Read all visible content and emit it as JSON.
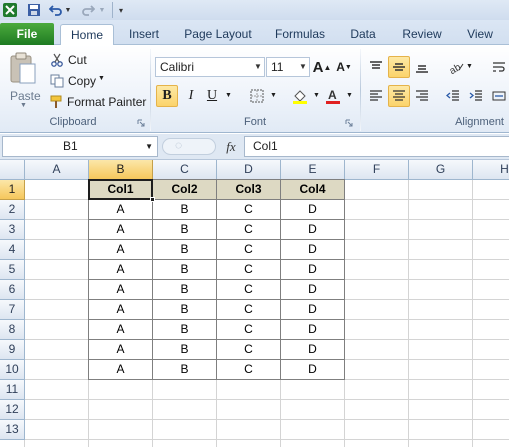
{
  "ribbon_tabs": {
    "file": "File",
    "home": "Home",
    "insert": "Insert",
    "page_layout": "Page Layout",
    "formulas": "Formulas",
    "data": "Data",
    "review": "Review",
    "view": "View"
  },
  "clipboard": {
    "paste": "Paste",
    "cut": "Cut",
    "copy": "Copy",
    "format_painter": "Format Painter",
    "group_label": "Clipboard"
  },
  "font": {
    "name": "Calibri",
    "size": "11",
    "bold": "B",
    "italic": "I",
    "underline": "U",
    "group_label": "Font"
  },
  "alignment": {
    "group_label": "Alignment"
  },
  "formula_bar": {
    "name_box": "B1",
    "fx": "fx",
    "content": "Col1"
  },
  "grid": {
    "columns": [
      "A",
      "B",
      "C",
      "D",
      "E",
      "F",
      "G",
      "H"
    ],
    "rows": [
      "1",
      "2",
      "3",
      "4",
      "5",
      "6",
      "7",
      "8",
      "9",
      "10",
      "11",
      "12",
      "13"
    ],
    "selected_column": "B",
    "selected_row": "1"
  },
  "table": {
    "headers": [
      "Col1",
      "Col2",
      "Col3",
      "Col4"
    ],
    "rows": [
      [
        "A",
        "B",
        "C",
        "D"
      ],
      [
        "A",
        "B",
        "C",
        "D"
      ],
      [
        "A",
        "B",
        "C",
        "D"
      ],
      [
        "A",
        "B",
        "C",
        "D"
      ],
      [
        "A",
        "B",
        "C",
        "D"
      ],
      [
        "A",
        "B",
        "C",
        "D"
      ],
      [
        "A",
        "B",
        "C",
        "D"
      ],
      [
        "A",
        "B",
        "C",
        "D"
      ],
      [
        "A",
        "B",
        "C",
        "D"
      ]
    ]
  },
  "colors": {
    "header_fill": "#ddd9c3",
    "selection_header": "#f6c75c",
    "file_tab": "#2a8a2c",
    "font_color_bar": "#e02020",
    "highlight_bar": "#ffff00"
  }
}
